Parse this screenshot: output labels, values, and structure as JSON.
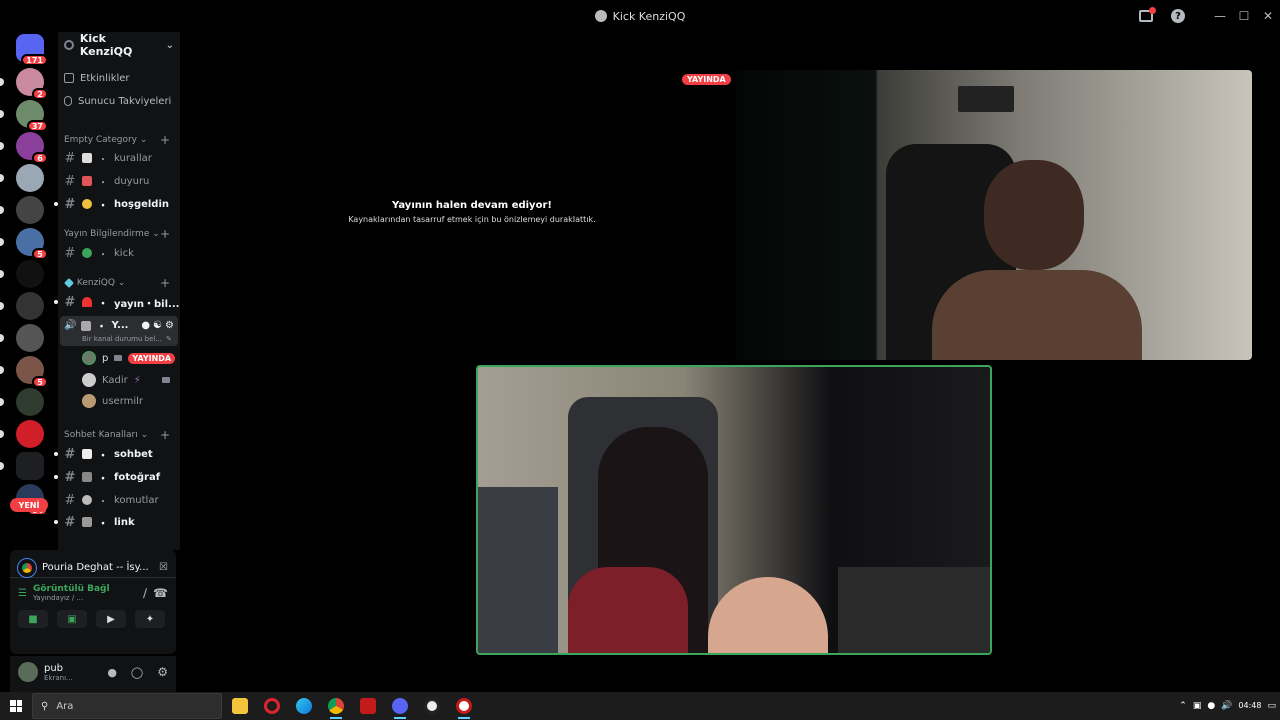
{
  "titlebar": {
    "title": "Kick KenziQQ"
  },
  "servers": [
    {
      "name": "dm-home",
      "badge": "171",
      "color": "#5865f2"
    },
    {
      "name": "server-1",
      "badge": "2",
      "color": "#c98aa0"
    },
    {
      "name": "server-2",
      "badge": "37",
      "color": "#6d8a6a"
    },
    {
      "name": "server-3",
      "badge": "6",
      "color": "#8a3f9a"
    },
    {
      "name": "server-4",
      "badge": "",
      "color": "#9aa7b4"
    },
    {
      "name": "server-5",
      "badge": "",
      "color": "#444"
    },
    {
      "name": "server-6",
      "badge": "5",
      "color": "#4a6fa5"
    },
    {
      "name": "server-7",
      "badge": "",
      "color": "#111"
    },
    {
      "name": "server-8",
      "badge": "",
      "color": "#333"
    },
    {
      "name": "server-9",
      "badge": "",
      "color": "#555"
    },
    {
      "name": "server-10",
      "badge": "5",
      "color": "#7a5548"
    },
    {
      "name": "server-11",
      "badge": "",
      "color": "#2e3b2e"
    },
    {
      "name": "server-12",
      "badge": "",
      "color": "#d11f2a"
    },
    {
      "name": "server-13",
      "badge": "",
      "color": "#1e1f22"
    },
    {
      "name": "server-14",
      "badge": "64",
      "color": "#2a3a5a"
    }
  ],
  "rail": {
    "new_label": "YENİ"
  },
  "sidebar": {
    "server_name": "Kick KenziQQ",
    "events": "Etkinlikler",
    "boosts": "Sunucu Takviyeleri",
    "cat_empty": "Empty Category",
    "ch_kurallar": "kurallar",
    "ch_duyuru": "duyuru",
    "ch_hosgeldin": "hoşgeldin",
    "cat_yayin": "Yayın Bilgilendirme",
    "ch_kick": "kick",
    "cat_kenzi": "KenziQQ",
    "ch_yayin_bil": "yayın・bil...",
    "voice_channel": "Y...",
    "voice_status": "Bir kanal durumu bel...",
    "voice_users": [
      {
        "name": "p",
        "live": "YAYINDA"
      },
      {
        "name": "Kadir",
        "live": ""
      },
      {
        "name": "usermilr",
        "live": ""
      }
    ],
    "cat_sohbet": "Sohbet Kanalları",
    "ch_sohbet": "sohbet",
    "ch_fotograf": "fotoğraf",
    "ch_komutlar": "komutlar",
    "ch_link": "link"
  },
  "voice_panel": {
    "activity": "Pouria Deghat -- İsy...",
    "connection": "Görüntülü Bağl",
    "connection_sub": "Yayındayız / ..."
  },
  "user_panel": {
    "username": "pub",
    "status": "Ekranı..."
  },
  "main": {
    "live_badge": "YAYINDA",
    "paused_title": "Yayının halen devam ediyor!",
    "paused_desc": "Kaynaklarından tasarruf etmek için bu önizlemeyi durakIattık."
  },
  "taskbar": {
    "search_placeholder": "Ara",
    "time": "04:48"
  }
}
